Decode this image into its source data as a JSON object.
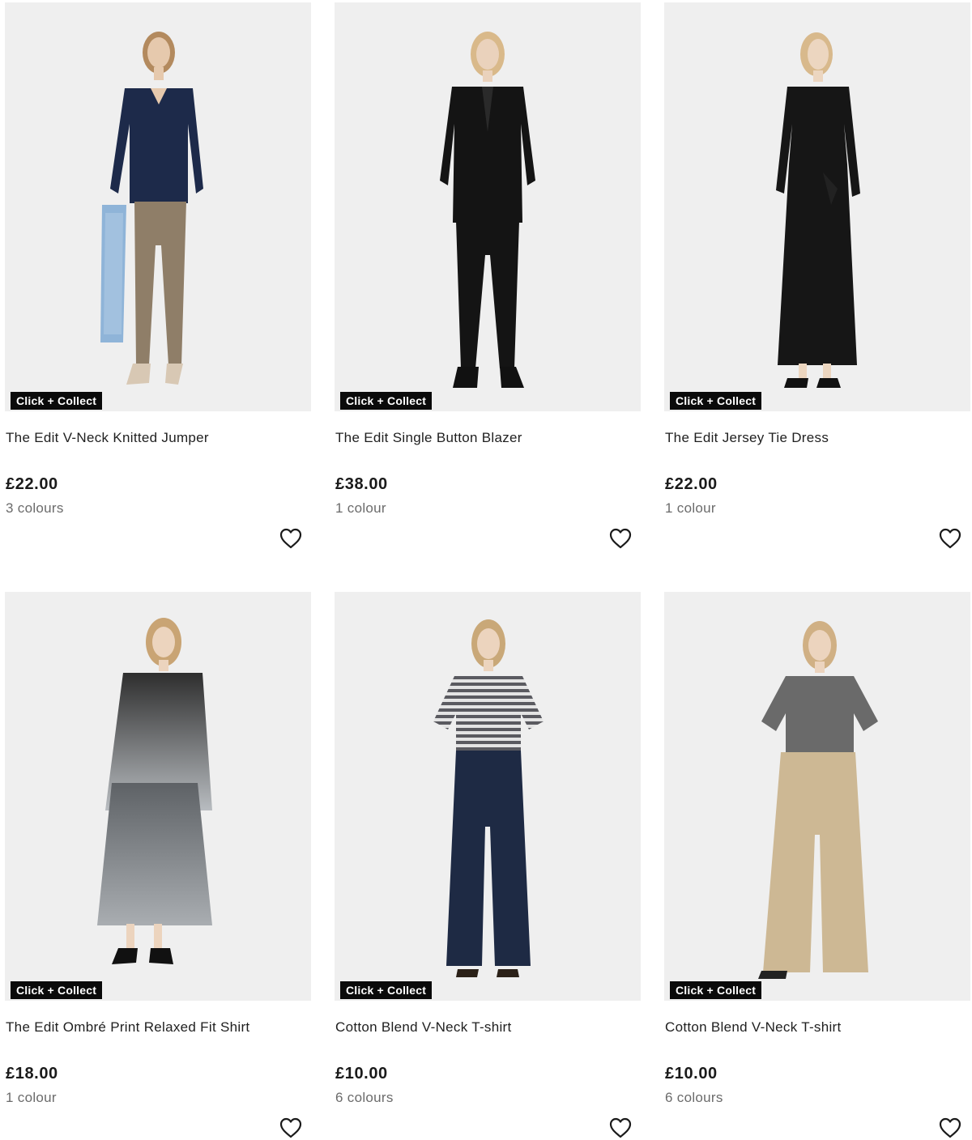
{
  "products": [
    {
      "badge": "Click + Collect",
      "name": "The Edit V-Neck Knitted Jumper",
      "price": "£22.00",
      "colours": "3 colours",
      "icon": "heart-outline-icon",
      "palette": {
        "top": "#1d2a4a",
        "bottom": "#8f7e68",
        "shoes": "#d8c8b4",
        "accent": "#8fb4d8"
      }
    },
    {
      "badge": "Click + Collect",
      "name": "The Edit Single Button Blazer",
      "price": "£38.00",
      "colours": "1 colour",
      "icon": "heart-outline-icon",
      "palette": {
        "top": "#141414",
        "bottom": "#141414",
        "shoes": "#111111",
        "accent": "#141414"
      }
    },
    {
      "badge": "Click + Collect",
      "name": "The Edit Jersey Tie Dress",
      "price": "£22.00",
      "colours": "1 colour",
      "icon": "heart-outline-icon",
      "palette": {
        "top": "#161616",
        "bottom": "#161616",
        "shoes": "#111111",
        "accent": "#161616"
      }
    },
    {
      "badge": "Click + Collect",
      "name": "The Edit Ombré Print Relaxed Fit Shirt",
      "price": "£18.00",
      "colours": "1 colour",
      "icon": "heart-outline-icon",
      "palette": {
        "top": "#3a3a3a",
        "bottom": "#8d9296",
        "shoes": "#111111",
        "accent": "#b8bcc0"
      }
    },
    {
      "badge": "Click + Collect",
      "name": "Cotton Blend V-Neck T-shirt",
      "price": "£10.00",
      "colours": "6 colours",
      "icon": "heart-outline-icon",
      "palette": {
        "top": "#6e6e72",
        "bottom": "#1e2a44",
        "shoes": "#2b2118",
        "accent": "#d8d8d8"
      }
    },
    {
      "badge": "Click + Collect",
      "name": "Cotton Blend V-Neck T-shirt",
      "price": "£10.00",
      "colours": "6 colours",
      "icon": "heart-outline-icon",
      "palette": {
        "top": "#6a6a6a",
        "bottom": "#cdb894",
        "shoes": "#222222",
        "accent": "#cdb894"
      }
    }
  ]
}
